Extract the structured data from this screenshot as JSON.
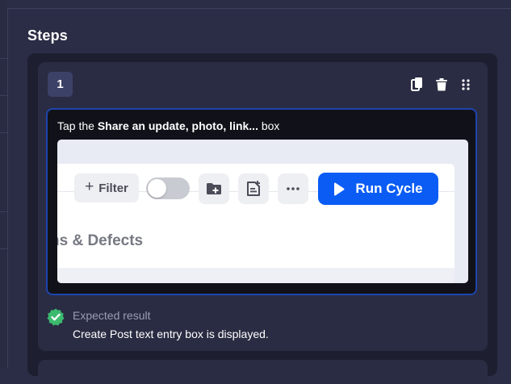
{
  "section": {
    "title": "Steps"
  },
  "step": {
    "number": "1",
    "instruction": {
      "prefix": "Tap the ",
      "bold": "Share an update, photo, link...",
      "suffix": " box"
    },
    "actions": {
      "copy_icon": "copy-icon",
      "delete_icon": "trash-icon",
      "drag_icon": "drag-handle-icon"
    },
    "screenshot": {
      "filter_label": "Filter",
      "run_label": "Run Cycle",
      "section_text": "ns & Defects",
      "icons": [
        "folder-add-icon",
        "note-add-icon",
        "more-icon",
        "play-icon"
      ]
    },
    "expected": {
      "label": "Expected result",
      "text": "Create Post text entry box is displayed."
    }
  },
  "colors": {
    "background": "#2a2d45",
    "panel": "#1d1f31",
    "card": "#2a2c43",
    "number_badge": "#3c4168",
    "focus_border": "#1e45ad",
    "run_button": "#0a5cf5",
    "success": "#3cba6e"
  }
}
